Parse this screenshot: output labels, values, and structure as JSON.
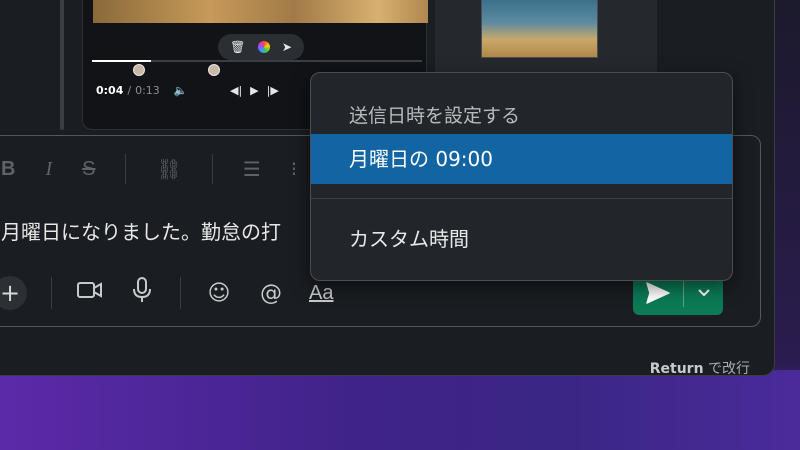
{
  "video": {
    "current_time": "0:04",
    "separator": "/",
    "duration": "0:13",
    "progress": 0.18
  },
  "formatting_icons": [
    "bold-icon",
    "italic-icon",
    "strikethrough-icon",
    "link-icon",
    "numbered-list-icon",
    "bulleted-list-icon"
  ],
  "format_labels": {
    "bold": "B",
    "italic": "I",
    "strike": "S"
  },
  "composer": {
    "message": "月曜日になりました。勤怠の打",
    "text_style_label": "Aa"
  },
  "schedule_menu": {
    "title": "送信日時を設定する",
    "selected_option": "月曜日の 09:00",
    "custom_option": "カスタム時間"
  },
  "hint": {
    "key": "Return",
    "text": "で改行"
  },
  "colors": {
    "send_button": "#0b7a55",
    "menu_selected": "#1264a3",
    "window_bg": "#1a1d21"
  }
}
